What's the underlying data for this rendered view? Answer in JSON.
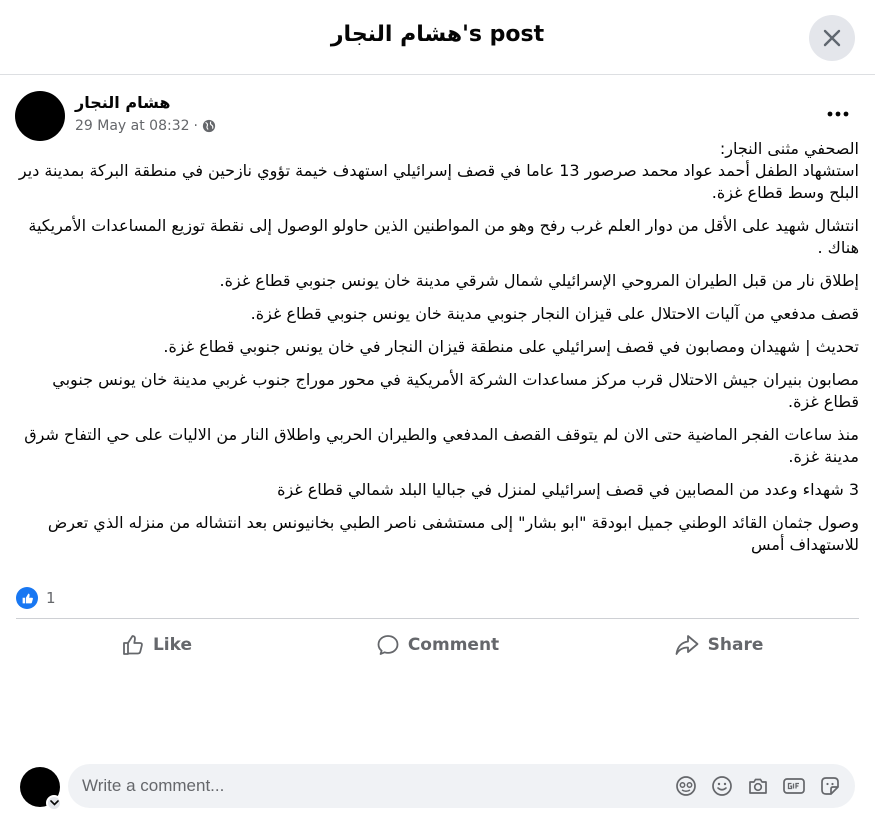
{
  "header": {
    "title": "هشام النجار's post"
  },
  "post": {
    "author": "هشام النجار",
    "timestamp": "29 May at 08:32",
    "meta_separator": "·",
    "privacy_icon": "globe-icon",
    "paragraphs": [
      "الصحفي مثنى النجار:",
      "استشهاد الطفل أحمد عواد محمد صرصور 13 عاما في قصف إسرائيلي استهدف خيمة تؤوي نازحين في منطقة البركة بمدينة دير البلح وسط قطاع غزة.",
      "انتشال شهيد على الأقل من دوار العلم غرب رفح وهو من المواطنين الذين حاولو الوصول إلى نقطة توزيع المساعدات الأمريكية هناك .",
      "إطلاق نار من قبل الطيران المروحي الإسرائيلي شمال شرقي مدينة خان يونس جنوبي قطاع غزة.",
      "قصف مدفعي من آليات الاحتلال على قيزان النجار جنوبي مدينة خان يونس جنوبي قطاع غزة.",
      "تحديث | شهيدان ومصابون في قصف إسرائيلي على منطقة قيزان النجار في خان يونس جنوبي قطاع غزة.",
      "مصابون بنيران جيش الاحتلال قرب مركز مساعدات الشركة الأمريكية في محور موراج جنوب غربي مدينة خان يونس جنوبي قطاع غزة.",
      "منذ ساعات الفجر الماضية حتى الان  لم يتوقف القصف المدفعي والطيران الحربي واطلاق النار من الاليات على حي التفاح شرق مدينة غزة.",
      "3 شهداء وعدد من المصابين في قصف إسرائيلي لمنزل في جباليا البلد شمالي قطاع غزة",
      "وصول جثمان القائد الوطني جميل ابودقة \"ابو بشار\" إلى مستشفى ناصر الطبي بخانيونس بعد انتشاله من منزله الذي تعرض للاستهداف أمس"
    ],
    "reaction_count": "1"
  },
  "actions": {
    "like": "Like",
    "comment": "Comment",
    "share": "Share"
  },
  "composer": {
    "placeholder": "Write a comment...",
    "icons": [
      "avatar-sticker-icon",
      "emoji-icon",
      "camera-icon",
      "gif-icon",
      "sticker-icon"
    ]
  },
  "colors": {
    "accent": "#1877f2",
    "muted": "#65676b",
    "surface": "#f0f2f5"
  }
}
